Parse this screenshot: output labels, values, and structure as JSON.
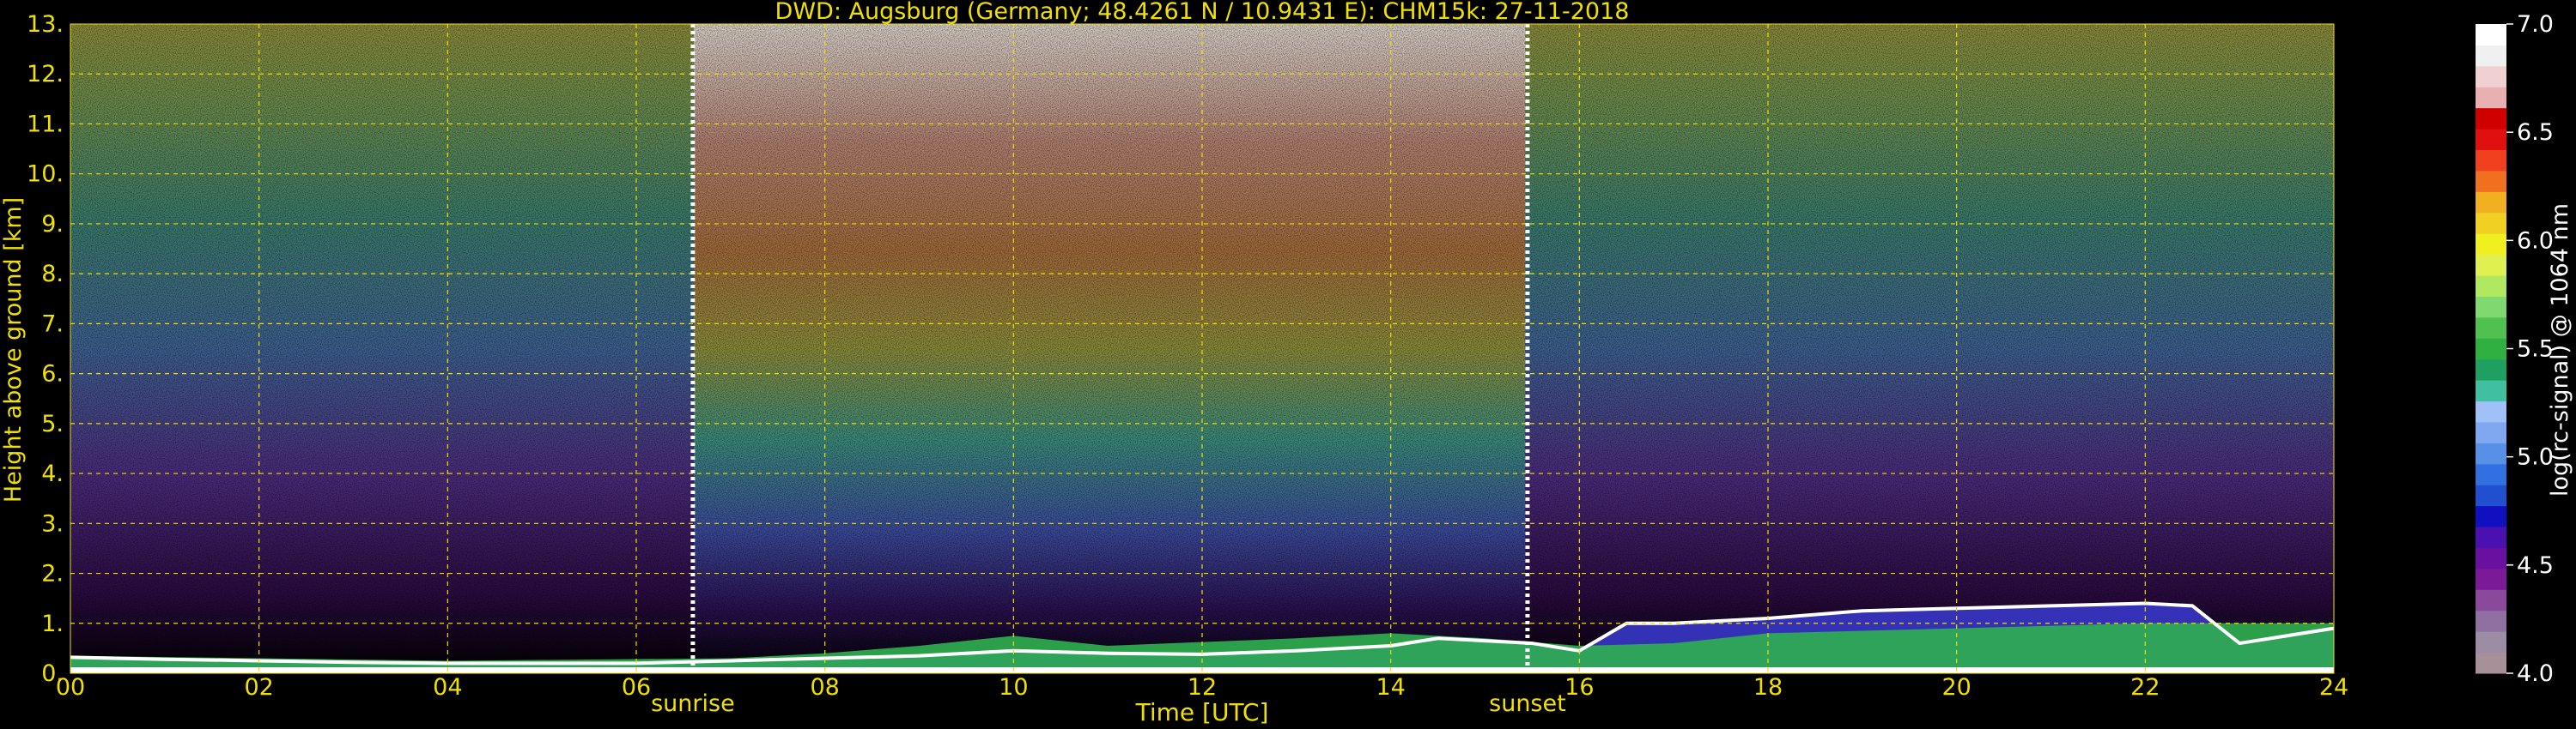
{
  "chart_data": {
    "type": "heatmap",
    "title": "DWD: Augsburg (Germany; 48.4261 N / 10.9431 E):    CHM15k: 27-11-2018",
    "xlabel": "Time [UTC]",
    "ylabel": "Height above ground [km]",
    "xlim": [
      0,
      24
    ],
    "ylim": [
      0,
      13
    ],
    "xticks": [
      "00",
      "02",
      "04",
      "06",
      "08",
      "10",
      "12",
      "14",
      "16",
      "18",
      "20",
      "22",
      "24"
    ],
    "yticks": [
      "0.",
      "1.",
      "2.",
      "3.",
      "4.",
      "5.",
      "6.",
      "7.",
      "8.",
      "9.",
      "10.",
      "11.",
      "12.",
      "13."
    ],
    "grid": true,
    "sunrise": {
      "label": "sunrise",
      "time": 6.6
    },
    "sunset": {
      "label": "sunset",
      "time": 15.45
    },
    "colorbar": {
      "label": "log(rc-signal) @ 1064 nm",
      "range": [
        4.0,
        7.0
      ],
      "ticks": [
        "4.0",
        "4.5",
        "5.0",
        "5.5",
        "6.0",
        "6.5",
        "7.0"
      ],
      "colors": [
        "#a89098",
        "#9c8ca4",
        "#9070a0",
        "#8a4a9c",
        "#7a1a96",
        "#6a10a0",
        "#4a10b0",
        "#1010c0",
        "#2050d0",
        "#3070e0",
        "#5890e8",
        "#80a8f0",
        "#a0c0f8",
        "#40c0a0",
        "#20a060",
        "#30b040",
        "#50c050",
        "#80d870",
        "#b0e860",
        "#e0f050",
        "#f0f020",
        "#f0d020",
        "#f0b020",
        "#f07020",
        "#f04020",
        "#e01010",
        "#d00000",
        "#e8b0b0",
        "#f0d0d0",
        "#f0f0f0",
        "#ffffff"
      ]
    },
    "boundary_layer_top_km": [
      [
        0,
        0.32
      ],
      [
        1,
        0.28
      ],
      [
        2,
        0.25
      ],
      [
        3,
        0.22
      ],
      [
        4,
        0.2
      ],
      [
        5,
        0.2
      ],
      [
        6,
        0.2
      ],
      [
        7,
        0.25
      ],
      [
        8,
        0.3
      ],
      [
        9,
        0.35
      ],
      [
        10,
        0.45
      ],
      [
        11,
        0.4
      ],
      [
        12,
        0.38
      ],
      [
        13,
        0.45
      ],
      [
        14,
        0.55
      ],
      [
        14.5,
        0.7
      ],
      [
        15.5,
        0.6
      ],
      [
        16,
        0.45
      ],
      [
        16.5,
        1.0
      ],
      [
        17,
        1.0
      ],
      [
        18,
        1.1
      ],
      [
        19,
        1.25
      ],
      [
        20,
        1.3
      ],
      [
        21,
        1.35
      ],
      [
        22,
        1.4
      ],
      [
        22.5,
        1.35
      ],
      [
        23,
        0.6
      ],
      [
        24,
        0.9
      ]
    ],
    "aerosol_layer_top_km": [
      [
        0,
        0.35
      ],
      [
        4,
        0.25
      ],
      [
        7,
        0.3
      ],
      [
        8,
        0.4
      ],
      [
        9,
        0.55
      ],
      [
        10,
        0.75
      ],
      [
        11,
        0.55
      ],
      [
        13,
        0.7
      ],
      [
        14,
        0.8
      ],
      [
        15,
        0.7
      ],
      [
        16,
        0.55
      ],
      [
        17,
        0.6
      ],
      [
        18,
        0.8
      ],
      [
        20,
        0.9
      ],
      [
        22,
        1.0
      ],
      [
        24,
        1.0
      ]
    ]
  }
}
